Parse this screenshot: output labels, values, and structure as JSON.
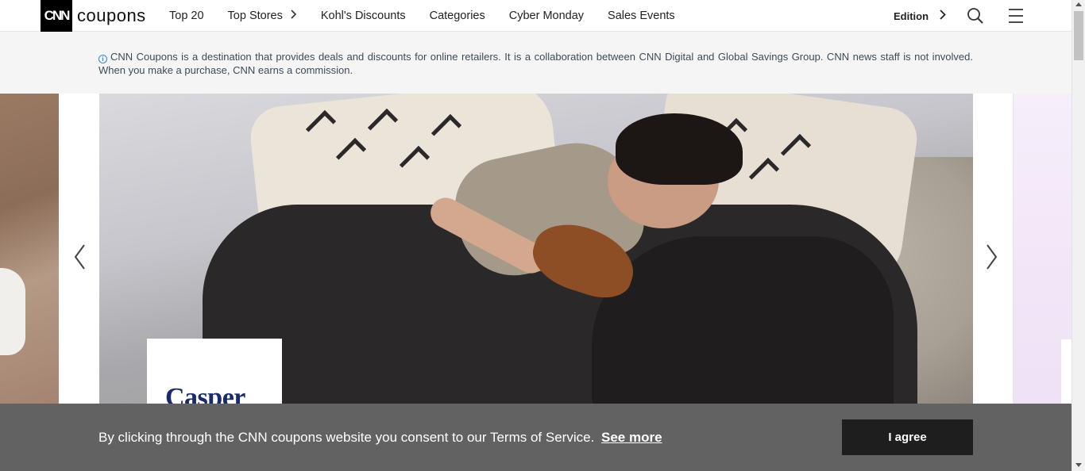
{
  "header": {
    "logo_mark": "CNN",
    "logo_word": "coupons",
    "nav": [
      {
        "label": "Top 20"
      },
      {
        "label": "Top Stores"
      },
      {
        "label": "Kohl's Discounts"
      },
      {
        "label": "Categories"
      },
      {
        "label": "Cyber Monday"
      },
      {
        "label": "Sales Events"
      }
    ],
    "edition_label": "Edition",
    "icons": {
      "search": "search-icon",
      "menu": "hamburger-menu-icon",
      "chevron": "chevron-right-icon"
    }
  },
  "disclaimer": {
    "text": "CNN Coupons is a destination that provides deals and discounts for online retailers. It is a collaboration between CNN Digital and Global Savings Group. CNN news staff is not involved. When you make a purchase, CNN earns a commission."
  },
  "carousel": {
    "brand_label": "Casper"
  },
  "consent": {
    "text": "By clicking through the CNN coupons website you consent to our Terms of Service.",
    "link_label": "See more",
    "button_label": "I agree"
  },
  "colors": {
    "consent_bg": "#626262",
    "button_bg": "#1e1e1e",
    "info_blue": "#2e86d1",
    "brand_navy": "#1a2a6c"
  }
}
